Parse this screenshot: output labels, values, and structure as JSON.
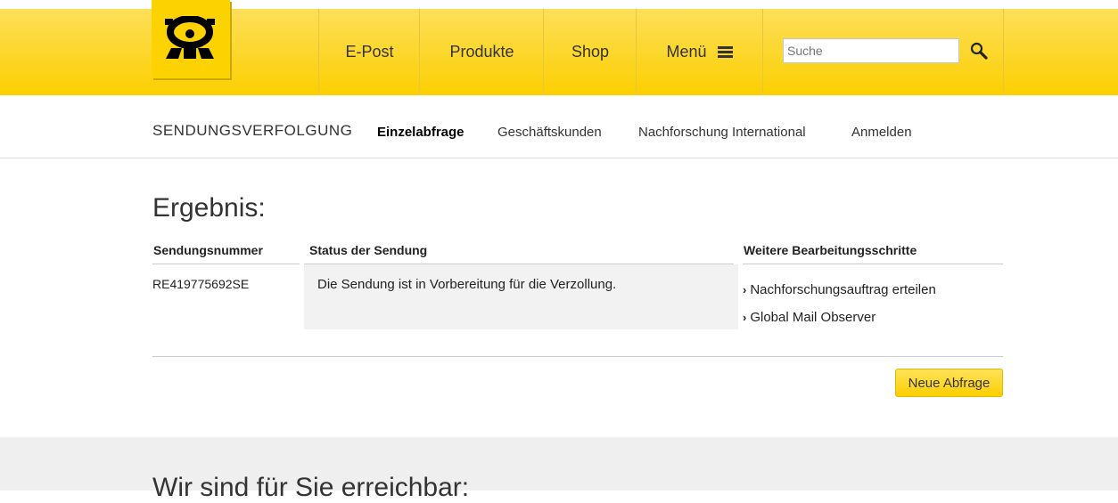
{
  "header": {
    "nav": [
      "E-Post",
      "Produkte",
      "Shop",
      "Menü"
    ],
    "search_placeholder": "Suche"
  },
  "subnav": {
    "title": "SENDUNGSVERFOLGUNG",
    "links": [
      "Einzelabfrage",
      "Geschäftskunden",
      "Nachforschung International",
      "Anmelden"
    ],
    "active": "Einzelabfrage"
  },
  "result": {
    "heading": "Ergebnis:",
    "columns": [
      "Sendungsnummer",
      "Status der Sendung",
      "Weitere Bearbeitungsschritte"
    ],
    "tracking_number": "RE419775692SE",
    "status": "Die Sendung ist in Vorbereitung für die Verzollung.",
    "steps": [
      "Nachforschungsauftrag erteilen",
      "Global Mail Observer"
    ],
    "new_query_button": "Neue Abfrage"
  },
  "footer": {
    "title": "Wir sind für Sie erreichbar:"
  },
  "colors": {
    "brand_yellow": "#fcd200"
  }
}
